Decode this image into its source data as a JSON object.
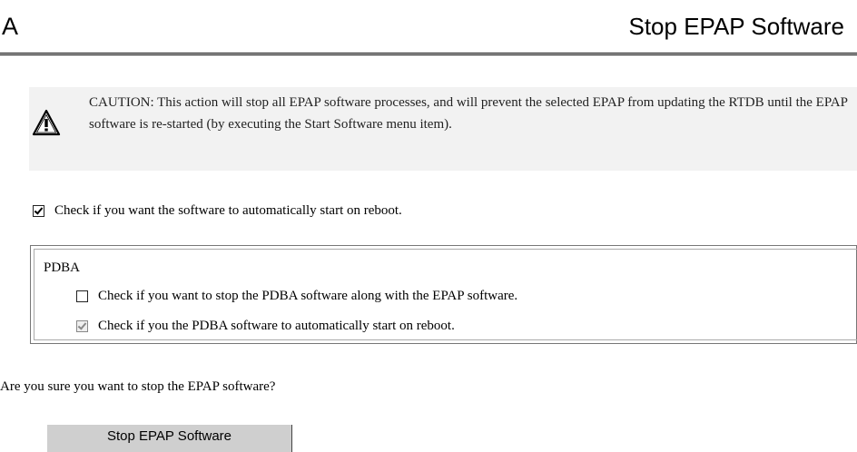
{
  "header": {
    "letter": "A",
    "title": "Stop EPAP Software"
  },
  "caution": {
    "icon": "warning-triangle-icon",
    "text": "CAUTION: This action will stop all EPAP software processes, and will prevent the selected EPAP from updating the RTDB until the EPAP software is re-started (by executing the Start Software menu item)."
  },
  "auto_start": {
    "label": "Check if you want the software to automatically start on reboot.",
    "checked": true
  },
  "pdba": {
    "title": "PDBA",
    "stop_option": {
      "label": "Check if you want to stop the PDBA software along with the EPAP software.",
      "checked": false
    },
    "auto_option": {
      "label": "Check if you the PDBA software to automatically start on reboot.",
      "checked": true,
      "disabled": true
    }
  },
  "question": "Are you sure you want to stop the EPAP software?",
  "submit_label": "Stop EPAP Software"
}
